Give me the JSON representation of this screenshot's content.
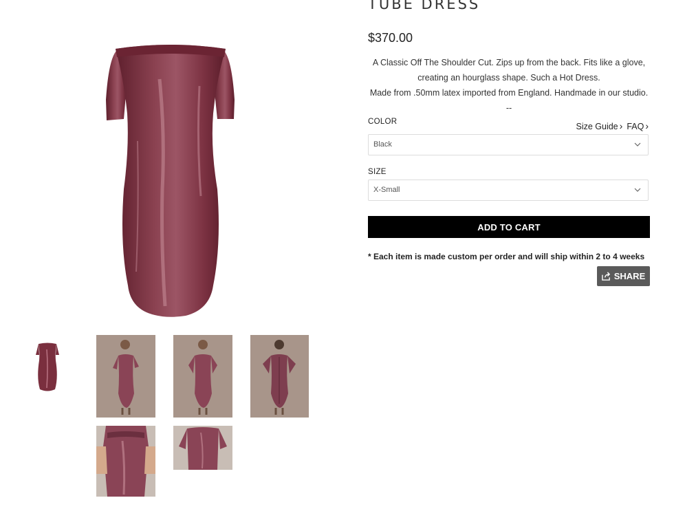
{
  "product": {
    "title": "TUBE DRESS",
    "price": "$370.00",
    "description": [
      "A Classic Off The Shoulder Cut. Zips up from the back. Fits like a glove,",
      "creating an hourglass shape. Such a Hot Dress.",
      "Made from .50mm latex imported from England. Handmade in our studio.",
      "--"
    ]
  },
  "options": {
    "color_label": "COLOR",
    "color_value": "Black",
    "size_label": "SIZE",
    "size_value": "X-Small",
    "size_guide_link": "Size Guide",
    "faq_link": "FAQ"
  },
  "actions": {
    "add_to_cart": "ADD TO CART",
    "share": "SHARE"
  },
  "note": "* Each item is made custom per order and will ship within 2 to 4 weeks",
  "colors": {
    "dress": "#7a2f3e",
    "dress_highlight": "#b97483",
    "backdrop": "#a8958a",
    "button": "#000000",
    "share_button": "#5a5a5a"
  },
  "icons": [
    "chevron-right-icon",
    "chevron-down-icon",
    "share-icon"
  ]
}
